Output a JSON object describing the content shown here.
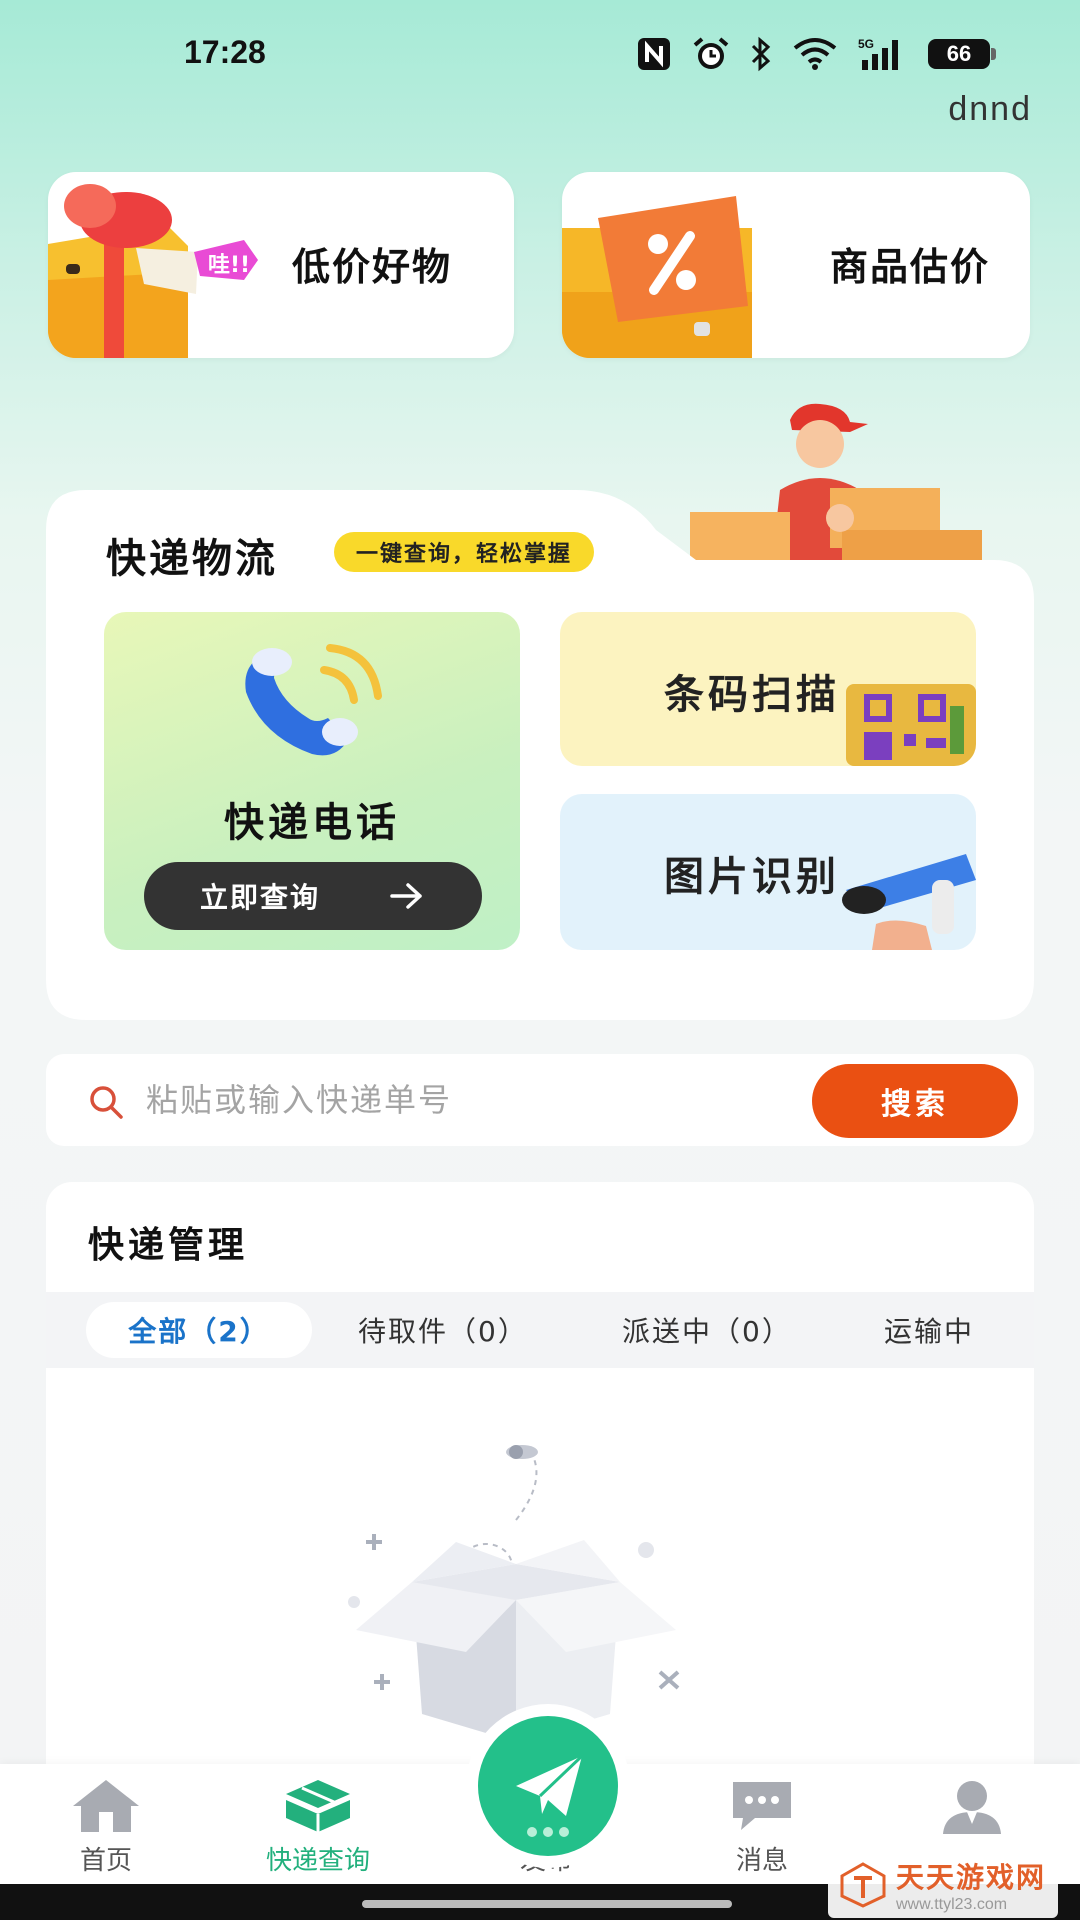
{
  "status_bar": {
    "time": "17:28",
    "battery": "66",
    "network": "5G",
    "icons": [
      "nfc-icon",
      "alarm-icon",
      "bluetooth-icon",
      "wifi-icon",
      "signal-icon",
      "battery-icon"
    ]
  },
  "header": {
    "user_name": "dnnd"
  },
  "promo": {
    "left": {
      "title": "低价好物",
      "sticker": "哇!!"
    },
    "right": {
      "title": "商品估价"
    }
  },
  "logistics": {
    "title": "快递物流",
    "badge": "一键查询，轻松掌握",
    "phone": {
      "title": "快递电话",
      "button": "立即查询"
    },
    "scan": {
      "title": "条码扫描"
    },
    "image": {
      "title": "图片识别"
    }
  },
  "search": {
    "placeholder": "粘贴或输入快递单号",
    "value": "",
    "button": "搜索"
  },
  "manage": {
    "title": "快递管理",
    "tabs": [
      {
        "label": "全部（2）",
        "active": true
      },
      {
        "label": "待取件（0）",
        "active": false
      },
      {
        "label": "派送中（0）",
        "active": false
      },
      {
        "label": "运输中",
        "active": false
      }
    ]
  },
  "nav": {
    "items": [
      {
        "label": "首页",
        "icon": "home-icon",
        "active": false
      },
      {
        "label": "快递查询",
        "icon": "package-icon",
        "active": true
      },
      {
        "label": "发布",
        "icon": "paper-plane-icon",
        "active": false
      },
      {
        "label": "消息",
        "icon": "message-icon",
        "active": false
      },
      {
        "label": "",
        "icon": "user-icon",
        "active": false
      }
    ]
  },
  "watermark": {
    "title": "天天游戏网",
    "url": "www.ttyl23.com"
  },
  "colors": {
    "accent_green": "#23c08a",
    "search_orange": "#ea5012",
    "tab_blue": "#1a73c9",
    "badge_yellow": "#f9d92a"
  }
}
